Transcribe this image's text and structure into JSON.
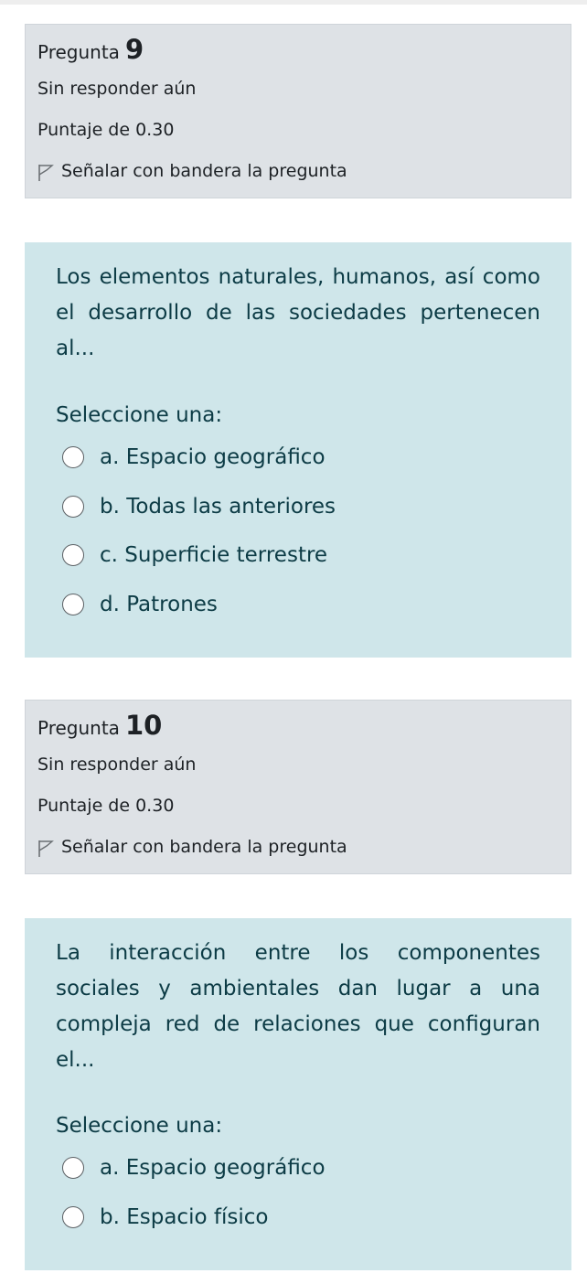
{
  "questions": [
    {
      "label": "Pregunta",
      "number": "9",
      "state": "Sin responder aún",
      "grade": "Puntaje de 0.30",
      "flag_label": "Señalar con bandera la pregunta",
      "prompt": "Los elementos naturales, humanos, así como el desarrollo de las sociedades pertenecen al...",
      "select_label": "Seleccione una:",
      "options": [
        "a. Espacio geográfico",
        "b. Todas las anteriores",
        "c. Superficie terrestre",
        "d. Patrones"
      ]
    },
    {
      "label": "Pregunta",
      "number": "10",
      "state": "Sin responder aún",
      "grade": "Puntaje de 0.30",
      "flag_label": "Señalar con bandera la pregunta",
      "prompt": "La interacción entre los componentes sociales y ambientales dan lugar a una compleja red de relaciones que configuran el...",
      "select_label": "Seleccione una:",
      "options": [
        "a. Espacio geográfico",
        "b. Espacio físico"
      ]
    }
  ],
  "colors": {
    "info_bg": "#dee2e6",
    "content_bg": "#cfe6ea",
    "content_text": "#0c3b45"
  }
}
